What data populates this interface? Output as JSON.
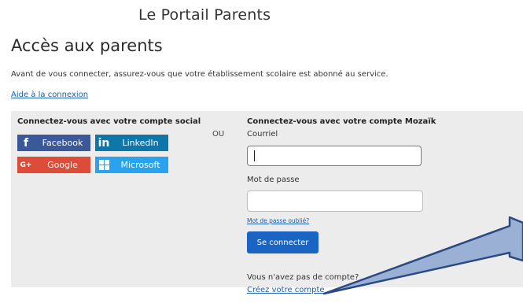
{
  "site": {
    "title": "Le Portail Parents"
  },
  "page": {
    "title": "Accès aux parents",
    "intro": "Avant de vous connecter, assurez-vous que votre établissement scolaire est abonné au service.",
    "help_link": "Aide à la connexion"
  },
  "social": {
    "title": "Connectez-vous avec votre compte social",
    "buttons": [
      {
        "label": "Facebook",
        "icon": "facebook-icon",
        "color": "#3b5998"
      },
      {
        "label": "LinkedIn",
        "icon": "linkedin-icon",
        "color": "#0e76a8"
      },
      {
        "label": "Google",
        "icon": "google-icon",
        "color": "#dd4b39"
      },
      {
        "label": "Microsoft",
        "icon": "microsoft-icon",
        "color": "#2aa3ef"
      }
    ]
  },
  "separator": "OU",
  "mozaik": {
    "title": "Connectez-vous avec votre compte Mozaïk",
    "email_label": "Courriel",
    "email_value": "",
    "password_label": "Mot de passe",
    "password_value": "",
    "forgot_link": "Mot de passe oublié?",
    "submit_label": "Se connecter",
    "no_account": "Vous n'avez pas de compte?",
    "create_link": "Créez votre compte"
  },
  "colors": {
    "accent": "#1a64c4",
    "link": "#1f5fa8",
    "panel_bg": "#ececec",
    "arrow": "#3a5a96"
  }
}
